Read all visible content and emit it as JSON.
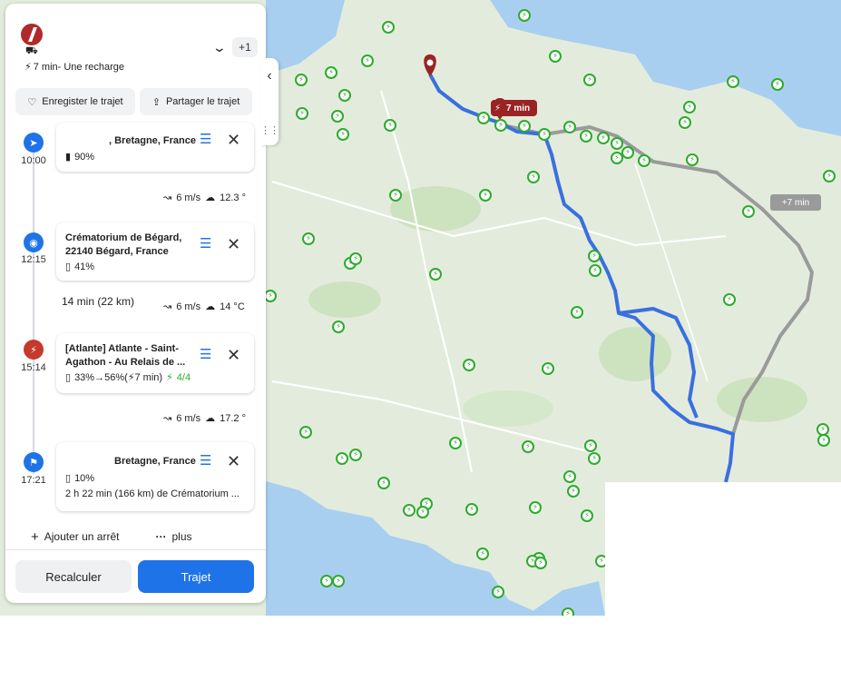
{
  "header": {
    "summary": "7 min- Une recharge",
    "extra_count": "+1",
    "car_glyph": "⛟"
  },
  "actions": {
    "save_label": "Enregister le trajet",
    "share_label": "Partager le trajet"
  },
  "stops": [
    {
      "time": "10:00",
      "title_line1": ", Bretagne, France",
      "title_line2": "",
      "battery": "90%"
    },
    {
      "time": "12:15",
      "title_line1": "Crématorium de Bégard,",
      "title_line2": "22140 Bégard, France",
      "battery": "41%"
    },
    {
      "time": "15:14",
      "title_line1": "[Atlante] Atlante - Saint-",
      "title_line2": "Agathon - Au Relais de ...",
      "battery_charge": "33%→56%(",
      "charge_time": "7 min)",
      "chargers": "4/4"
    },
    {
      "time": "17:21",
      "title_line1": "Bretagne, France",
      "battery": "10%",
      "note": "2 h 22 min (166 km) de Crématorium ..."
    }
  ],
  "legs": [
    {
      "wind": "6 m/s",
      "temp": "12.3 °"
    },
    {
      "distance": "14 min (22 km)",
      "wind": "6 m/s",
      "temp": "14 °C"
    },
    {
      "wind": "6 m/s",
      "temp": "17.2 °"
    }
  ],
  "footer": {
    "add_stop": "Ajouter un arrêt",
    "more": "plus",
    "recalc": "Recalculer",
    "route": "Trajet"
  },
  "map": {
    "pin_label": "7 min",
    "alt_label": "+7 min",
    "colors": {
      "route": "#3a6fe0",
      "alt_route": "#9a9a9a",
      "charger": "#2eaa2e",
      "pin": "#9a2323",
      "water": "#a9cff0",
      "land": "#e3ecdc"
    }
  }
}
